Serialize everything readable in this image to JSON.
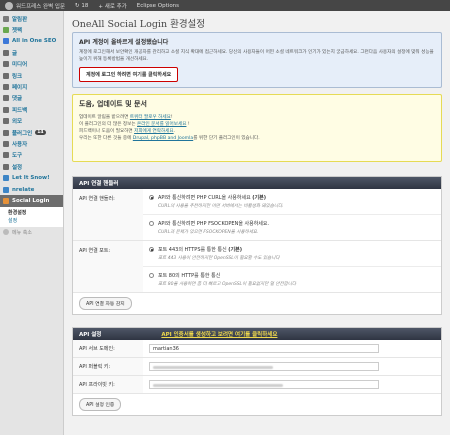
{
  "adminbar": {
    "site": "워드프레스 완벽 입문",
    "updates": "18",
    "new": "+ 새로 추가",
    "eclipse": "Eclipse Options"
  },
  "sidebar": {
    "items": [
      {
        "label": "알림판",
        "color": "#7a7a7a"
      },
      {
        "label": "젯팩",
        "color": "#6aa84f"
      },
      {
        "label": "All in One SEO",
        "color": "#3c78d8"
      },
      {
        "label": "글",
        "color": "#6d6d6d"
      },
      {
        "label": "미디어",
        "color": "#6d6d6d"
      },
      {
        "label": "링크",
        "color": "#6d6d6d"
      },
      {
        "label": "페이지",
        "color": "#6d6d6d"
      },
      {
        "label": "댓글",
        "color": "#6d6d6d"
      },
      {
        "label": "피드백",
        "color": "#6d6d6d"
      },
      {
        "label": "외모",
        "color": "#6d6d6d"
      },
      {
        "label": "플러그인",
        "color": "#6d6d6d",
        "badge": "14"
      },
      {
        "label": "사용자",
        "color": "#6d6d6d"
      },
      {
        "label": "도구",
        "color": "#6d6d6d"
      },
      {
        "label": "설정",
        "color": "#6d6d6d"
      },
      {
        "label": "Let It Snow!",
        "color": "#3d85c6"
      },
      {
        "label": "nrelate",
        "color": "#3d85c6"
      },
      {
        "label": "Social Login",
        "color": "#e69138"
      }
    ],
    "submenu": [
      "환경설정",
      "설정"
    ],
    "collapse": "메뉴 축소"
  },
  "main": {
    "title": "OneAll Social Login 환경설정",
    "notice": {
      "heading": "API 계정이 올바르게 설정됐습니다",
      "text": "계정에 로그인해서 보안확인 개공자를 관리하고 소셜 지식 확대에 접근하세요. 당신의 사용자들이 어떤 소셜 네트워크가 인기가 있는지 궁금하세요. 그런다음 사용자의 설정에 맞춰 성능을 높이기 위해 등록방법을 개선하세요.",
      "button": "계정에 로그인 하려면 여기를 클릭하세요"
    },
    "help": {
      "heading": "도움, 업데이트 및 문서",
      "line1_pre": "업데이트 알림을 받으려면 ",
      "line1_link": "트위터 팔로우 하세요",
      "line1_post": "!",
      "line2_pre": "이 플러그인의 더 많은 정보는 ",
      "line2_link": "온라인 문서를 읽어보세요",
      "line2_post": " !",
      "line3_pre": "피드백이나 도움이 필요하면 ",
      "line3_link": "저희에게 연락하세요",
      "line3_post": ".",
      "line4_pre": "우리는 또한 다른 것들 중에 ",
      "line4_link": "Drupal, phpBB and Joomla",
      "line4_post": "를 위한 단기 플러그인이 있습니다."
    },
    "api_handler": {
      "heading": "API 연결 핸들러",
      "label_handler": "API 연결 핸들러:",
      "opt1_title": "API와 통신하려면 PHP CURL을 사용하세요",
      "opt1_bold": "(기본)",
      "opt1_desc": "CURL의 사용을 추천하지만 어떤 서버에서는 비활성화 돼있습니다.",
      "opt2_title": "API와 통신하려면 PHP FSOCKOPEN을 사용하세요.",
      "opt2_desc": "CURL과 문제가 있으면 FSOCKOPEN을 사용하세요.",
      "label_port": "API 연결 포트:",
      "opt3_title": "포트 443의 HTTPS를 통한 통신",
      "opt3_bold": "(기본)",
      "opt3_desc": "포트 443 사용이 안전하지만 OpenSSL이 필요할 수도 있습니다",
      "opt4_title": "포트 80의 HTTP를 통한 통신",
      "opt4_desc": "포트 80을 사용하면 좀 더 빠르고 OpenSSL이 필요없지만 덜 안전합니다",
      "autodetect": "API 연결 자동 감지"
    },
    "api_settings": {
      "heading": "API 설정",
      "heading_link": "API 인증서를 생성하고 보려면 여기를 클릭하세요",
      "label_subdomain": "API 서브 도메인:",
      "subdomain_value": "martian36",
      "label_public": "API 퍼블릭 키:",
      "label_private": "API 프라이빗 키:",
      "verify": "API 설정 인증"
    }
  }
}
